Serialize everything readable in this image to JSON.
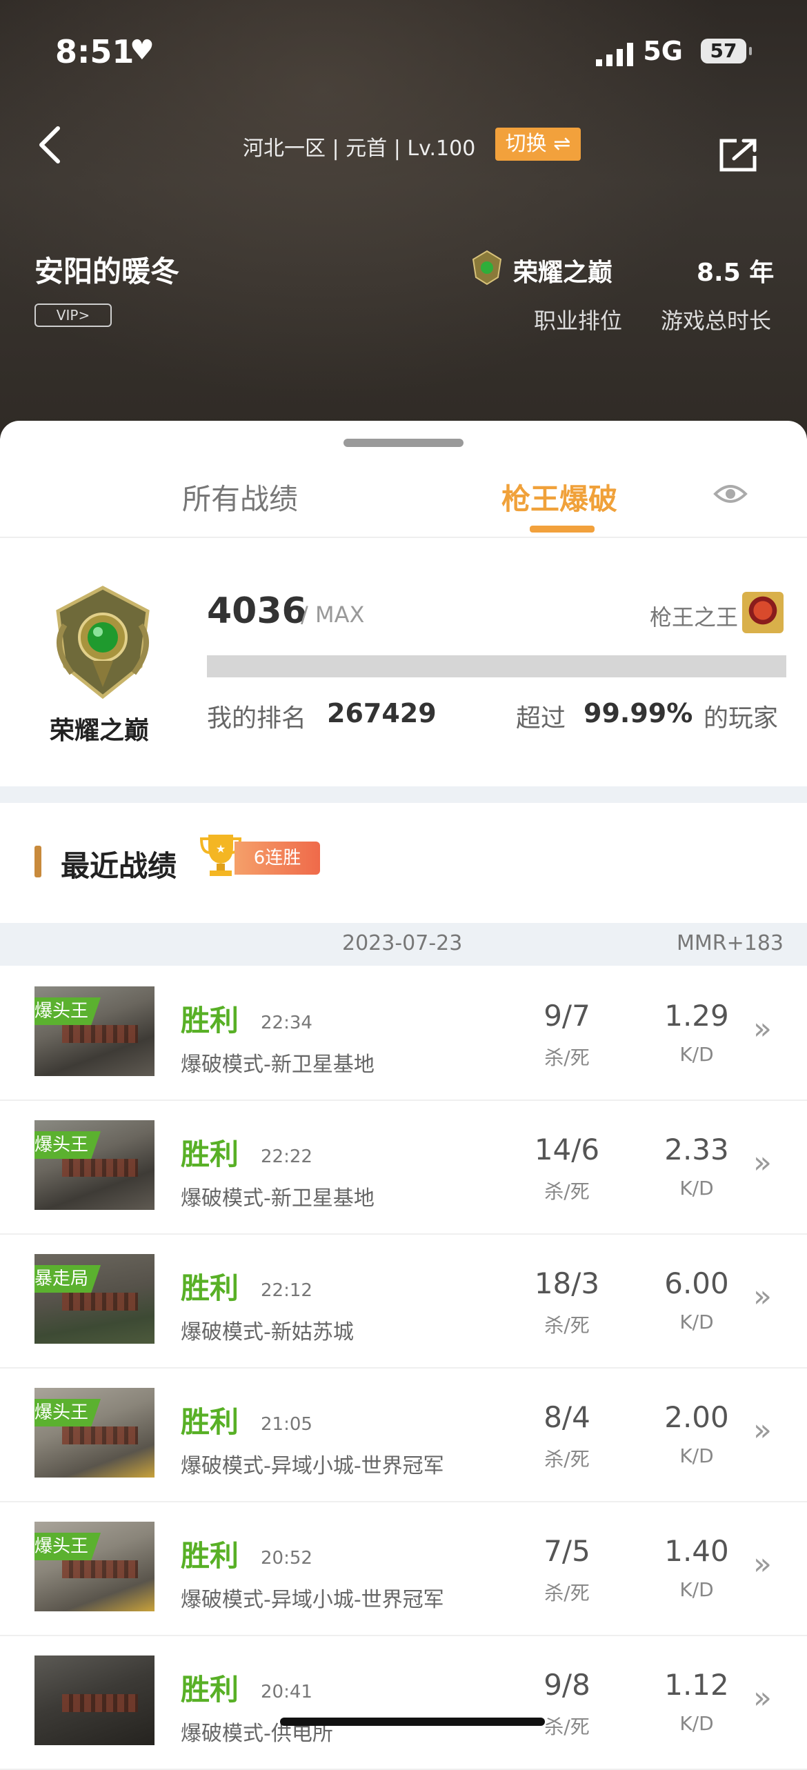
{
  "status_bar": {
    "time": "8:51",
    "heart": "♥",
    "network": "5G",
    "battery": "57"
  },
  "header": {
    "server_info": "河北一区 | 元首 | Lv.100",
    "switch_label": "切换 ⇌",
    "player_name": "安阳的暖冬",
    "vip_label": "VIP>",
    "rank_name": "荣耀之巅",
    "play_years": "8.5 年",
    "rank_caption": "职业排位",
    "time_caption": "游戏总时长"
  },
  "tabs": [
    {
      "label": "所有战绩",
      "active": false
    },
    {
      "label": "枪王爆破",
      "active": true
    }
  ],
  "rank_card": {
    "medal_name": "荣耀之巅",
    "score": "4036",
    "max_label": "/ MAX",
    "king_label": "枪王之王",
    "progress": 1.0,
    "my_rank_label": "我的排名",
    "my_rank_value": "267429",
    "exceed_label": "超过",
    "exceed_value": "99.99%",
    "players_label": "的玩家"
  },
  "recent": {
    "title": "最近战绩",
    "streak": "6连胜",
    "date": "2023-07-23",
    "mmr": "MMR+183",
    "kd_caption": "杀/死",
    "ratio_caption": "K/D",
    "matches": [
      {
        "tag": "爆头王",
        "result": "胜利",
        "time": "22:34",
        "mode": "爆破模式-新卫星基地",
        "kd": "9/7",
        "ratio": "1.29"
      },
      {
        "tag": "爆头王",
        "result": "胜利",
        "time": "22:22",
        "mode": "爆破模式-新卫星基地",
        "kd": "14/6",
        "ratio": "2.33"
      },
      {
        "tag": "暴走局",
        "result": "胜利",
        "time": "22:12",
        "mode": "爆破模式-新姑苏城",
        "kd": "18/3",
        "ratio": "6.00"
      },
      {
        "tag": "爆头王",
        "result": "胜利",
        "time": "21:05",
        "mode": "爆破模式-异域小城-世界冠军",
        "kd": "8/4",
        "ratio": "2.00"
      },
      {
        "tag": "爆头王",
        "result": "胜利",
        "time": "20:52",
        "mode": "爆破模式-异域小城-世界冠军",
        "kd": "7/5",
        "ratio": "1.40"
      },
      {
        "tag": "",
        "result": "胜利",
        "time": "20:41",
        "mode": "爆破模式-供电所",
        "kd": "9/8",
        "ratio": "1.12"
      }
    ]
  },
  "colors": {
    "accent": "#f2a13c",
    "win": "#58b026",
    "tag": "#5bb12f"
  },
  "icons": [
    "back-icon",
    "swap-icon",
    "share-icon",
    "eye-icon",
    "trophy-icon",
    "chevron-right-icon",
    "signal-icon"
  ]
}
